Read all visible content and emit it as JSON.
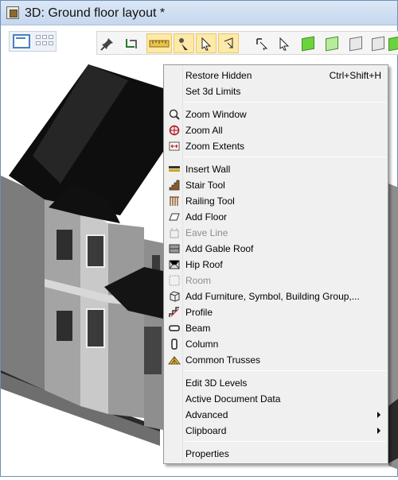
{
  "window": {
    "title": "3D: Ground floor layout *"
  },
  "toolbar": {
    "buttons": [
      {
        "name": "pin",
        "icon": "pin-icon"
      },
      {
        "name": "rotate-connect",
        "icon": "rotate-icon"
      },
      {
        "name": "measure",
        "icon": "ruler-icon"
      },
      {
        "name": "camera-walk",
        "icon": "camera-icon"
      },
      {
        "name": "select-arrow",
        "icon": "arrow-icon"
      },
      {
        "name": "select-edge",
        "icon": "arrow-edge-icon"
      },
      {
        "name": "select-object",
        "icon": "select-object-icon"
      },
      {
        "name": "pointer",
        "icon": "pointer-icon"
      },
      {
        "name": "solid-view",
        "icon": "cube-solid-icon"
      },
      {
        "name": "glass-view",
        "icon": "cube-glass-icon"
      },
      {
        "name": "wire-view",
        "icon": "cube-wire-icon"
      },
      {
        "name": "hidden-view",
        "icon": "cube-hidden-icon"
      },
      {
        "name": "render-view",
        "icon": "cube-render-icon"
      }
    ]
  },
  "menu": {
    "items": [
      {
        "label": "Restore Hidden",
        "shortcut": "Ctrl+Shift+H",
        "icon": "",
        "disabled": false
      },
      {
        "label": "Set 3d Limits",
        "shortcut": "",
        "icon": "",
        "disabled": false
      },
      {
        "label": "Zoom Window",
        "shortcut": "",
        "icon": "zoom-window-icon",
        "disabled": false
      },
      {
        "label": "Zoom All",
        "shortcut": "",
        "icon": "zoom-all-icon",
        "disabled": false
      },
      {
        "label": "Zoom Extents",
        "shortcut": "",
        "icon": "zoom-extents-icon",
        "disabled": false
      },
      {
        "label": "Insert Wall",
        "shortcut": "",
        "icon": "wall-icon",
        "disabled": false
      },
      {
        "label": "Stair Tool",
        "shortcut": "",
        "icon": "stair-icon",
        "disabled": false
      },
      {
        "label": "Railing Tool",
        "shortcut": "",
        "icon": "railing-icon",
        "disabled": false
      },
      {
        "label": "Add Floor",
        "shortcut": "",
        "icon": "floor-icon",
        "disabled": false
      },
      {
        "label": "Eave Line",
        "shortcut": "",
        "icon": "eave-line-icon",
        "disabled": true
      },
      {
        "label": "Add Gable Roof",
        "shortcut": "",
        "icon": "gable-roof-icon",
        "disabled": false
      },
      {
        "label": "Hip Roof",
        "shortcut": "",
        "icon": "hip-roof-icon",
        "disabled": false
      },
      {
        "label": "Room",
        "shortcut": "",
        "icon": "room-icon",
        "disabled": true
      },
      {
        "label": "Add Furniture, Symbol, Building Group,...",
        "shortcut": "",
        "icon": "furniture-icon",
        "disabled": false
      },
      {
        "label": "Profile",
        "shortcut": "",
        "icon": "profile-icon",
        "disabled": false
      },
      {
        "label": "Beam",
        "shortcut": "",
        "icon": "beam-icon",
        "disabled": false
      },
      {
        "label": "Column",
        "shortcut": "",
        "icon": "column-icon",
        "disabled": false
      },
      {
        "label": "Common Trusses",
        "shortcut": "",
        "icon": "truss-icon",
        "disabled": false
      },
      {
        "label": "Edit 3D Levels",
        "shortcut": "",
        "icon": "",
        "disabled": false
      },
      {
        "label": "Active Document Data",
        "shortcut": "",
        "icon": "",
        "disabled": false
      },
      {
        "label": "Advanced",
        "shortcut": "",
        "icon": "",
        "disabled": false,
        "submenu": true
      },
      {
        "label": "Clipboard",
        "shortcut": "",
        "icon": "",
        "disabled": false,
        "submenu": true
      },
      {
        "label": "Properties",
        "shortcut": "",
        "icon": "",
        "disabled": false
      }
    ]
  },
  "colors": {
    "highlight": "#fde9a8",
    "accent_green": "#6ad43c",
    "roof": "#111111",
    "wall": "#8e8e8e"
  }
}
